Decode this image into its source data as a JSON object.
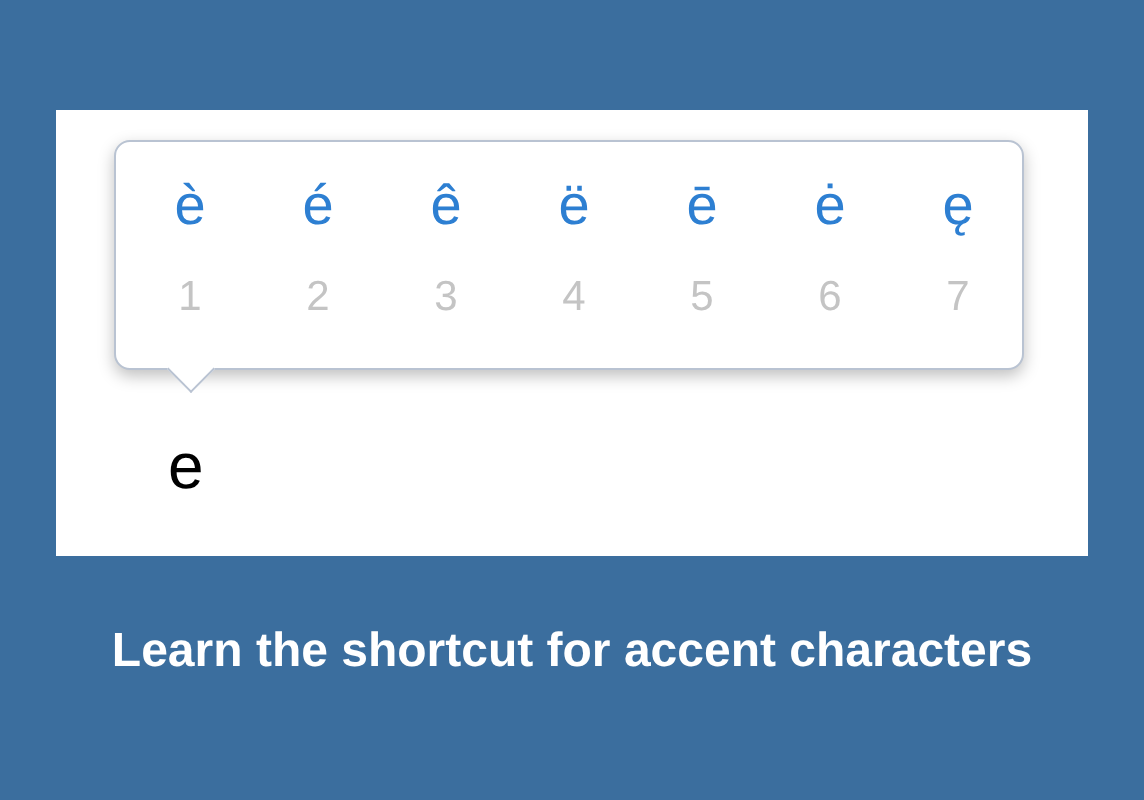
{
  "accent_popup": {
    "options": [
      {
        "char": "è",
        "number": "1"
      },
      {
        "char": "é",
        "number": "2"
      },
      {
        "char": "ê",
        "number": "3"
      },
      {
        "char": "ë",
        "number": "4"
      },
      {
        "char": "ē",
        "number": "5"
      },
      {
        "char": "ė",
        "number": "6"
      },
      {
        "char": "ę",
        "number": "7"
      }
    ]
  },
  "typed_text": "e",
  "caption": "Learn the shortcut for accent characters"
}
